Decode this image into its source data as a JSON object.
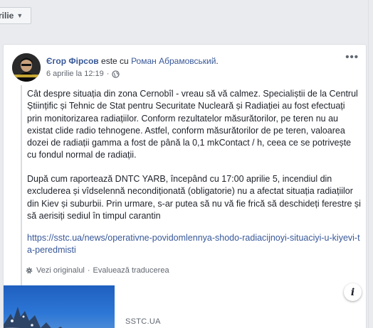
{
  "filter": {
    "label": "rilie"
  },
  "post": {
    "author": "Єгор Фірсов",
    "connector": "este cu",
    "tagged": "Роман Абрамовський",
    "date": "6 aprilie la 12:19",
    "separator": "·",
    "more": "•••"
  },
  "translation": {
    "paragraph1": "Cât despre situația din zona Cernobîl - vreau să vă calmez. Specialiștii de la Centrul Științific și Tehnic de Stat pentru Securitate Nucleară și Radiației au fost efectuați prin monitorizarea radiațiilor. Conform rezultatelor măsurătorilor, pe teren nu au existat clide radio tehnogene. Astfel, conform măsurătorilor de pe teren, valoarea dozei de radiații gamma a fost de până la 0,1 mkContact / h, ceea ce se potrivește cu fondul normal de radiații.",
    "paragraph2": "După cum raportează DNTC YARB, începând cu 17:00 aprilie 5, incendiul din excluderea și vîdselennă necondiționată (obligatorie) nu a afectat situația radiațiilor din Kiev și suburbii. Prin urmare, s-ar putea să nu vă fie frică să deschideți ferestre și să aerisiți sediul în timpul carantin",
    "link": "https://sstc.ua/news/operativne-povidomlennya-shodo-radiacijnoyi-situaciyi-u-kiyevi-ta-peredmisti",
    "view_original": "Vezi originalul",
    "dot": "·",
    "rate": "Evaluează traducerea"
  },
  "preview": {
    "domain": "SSTC.UA",
    "info": "i"
  }
}
